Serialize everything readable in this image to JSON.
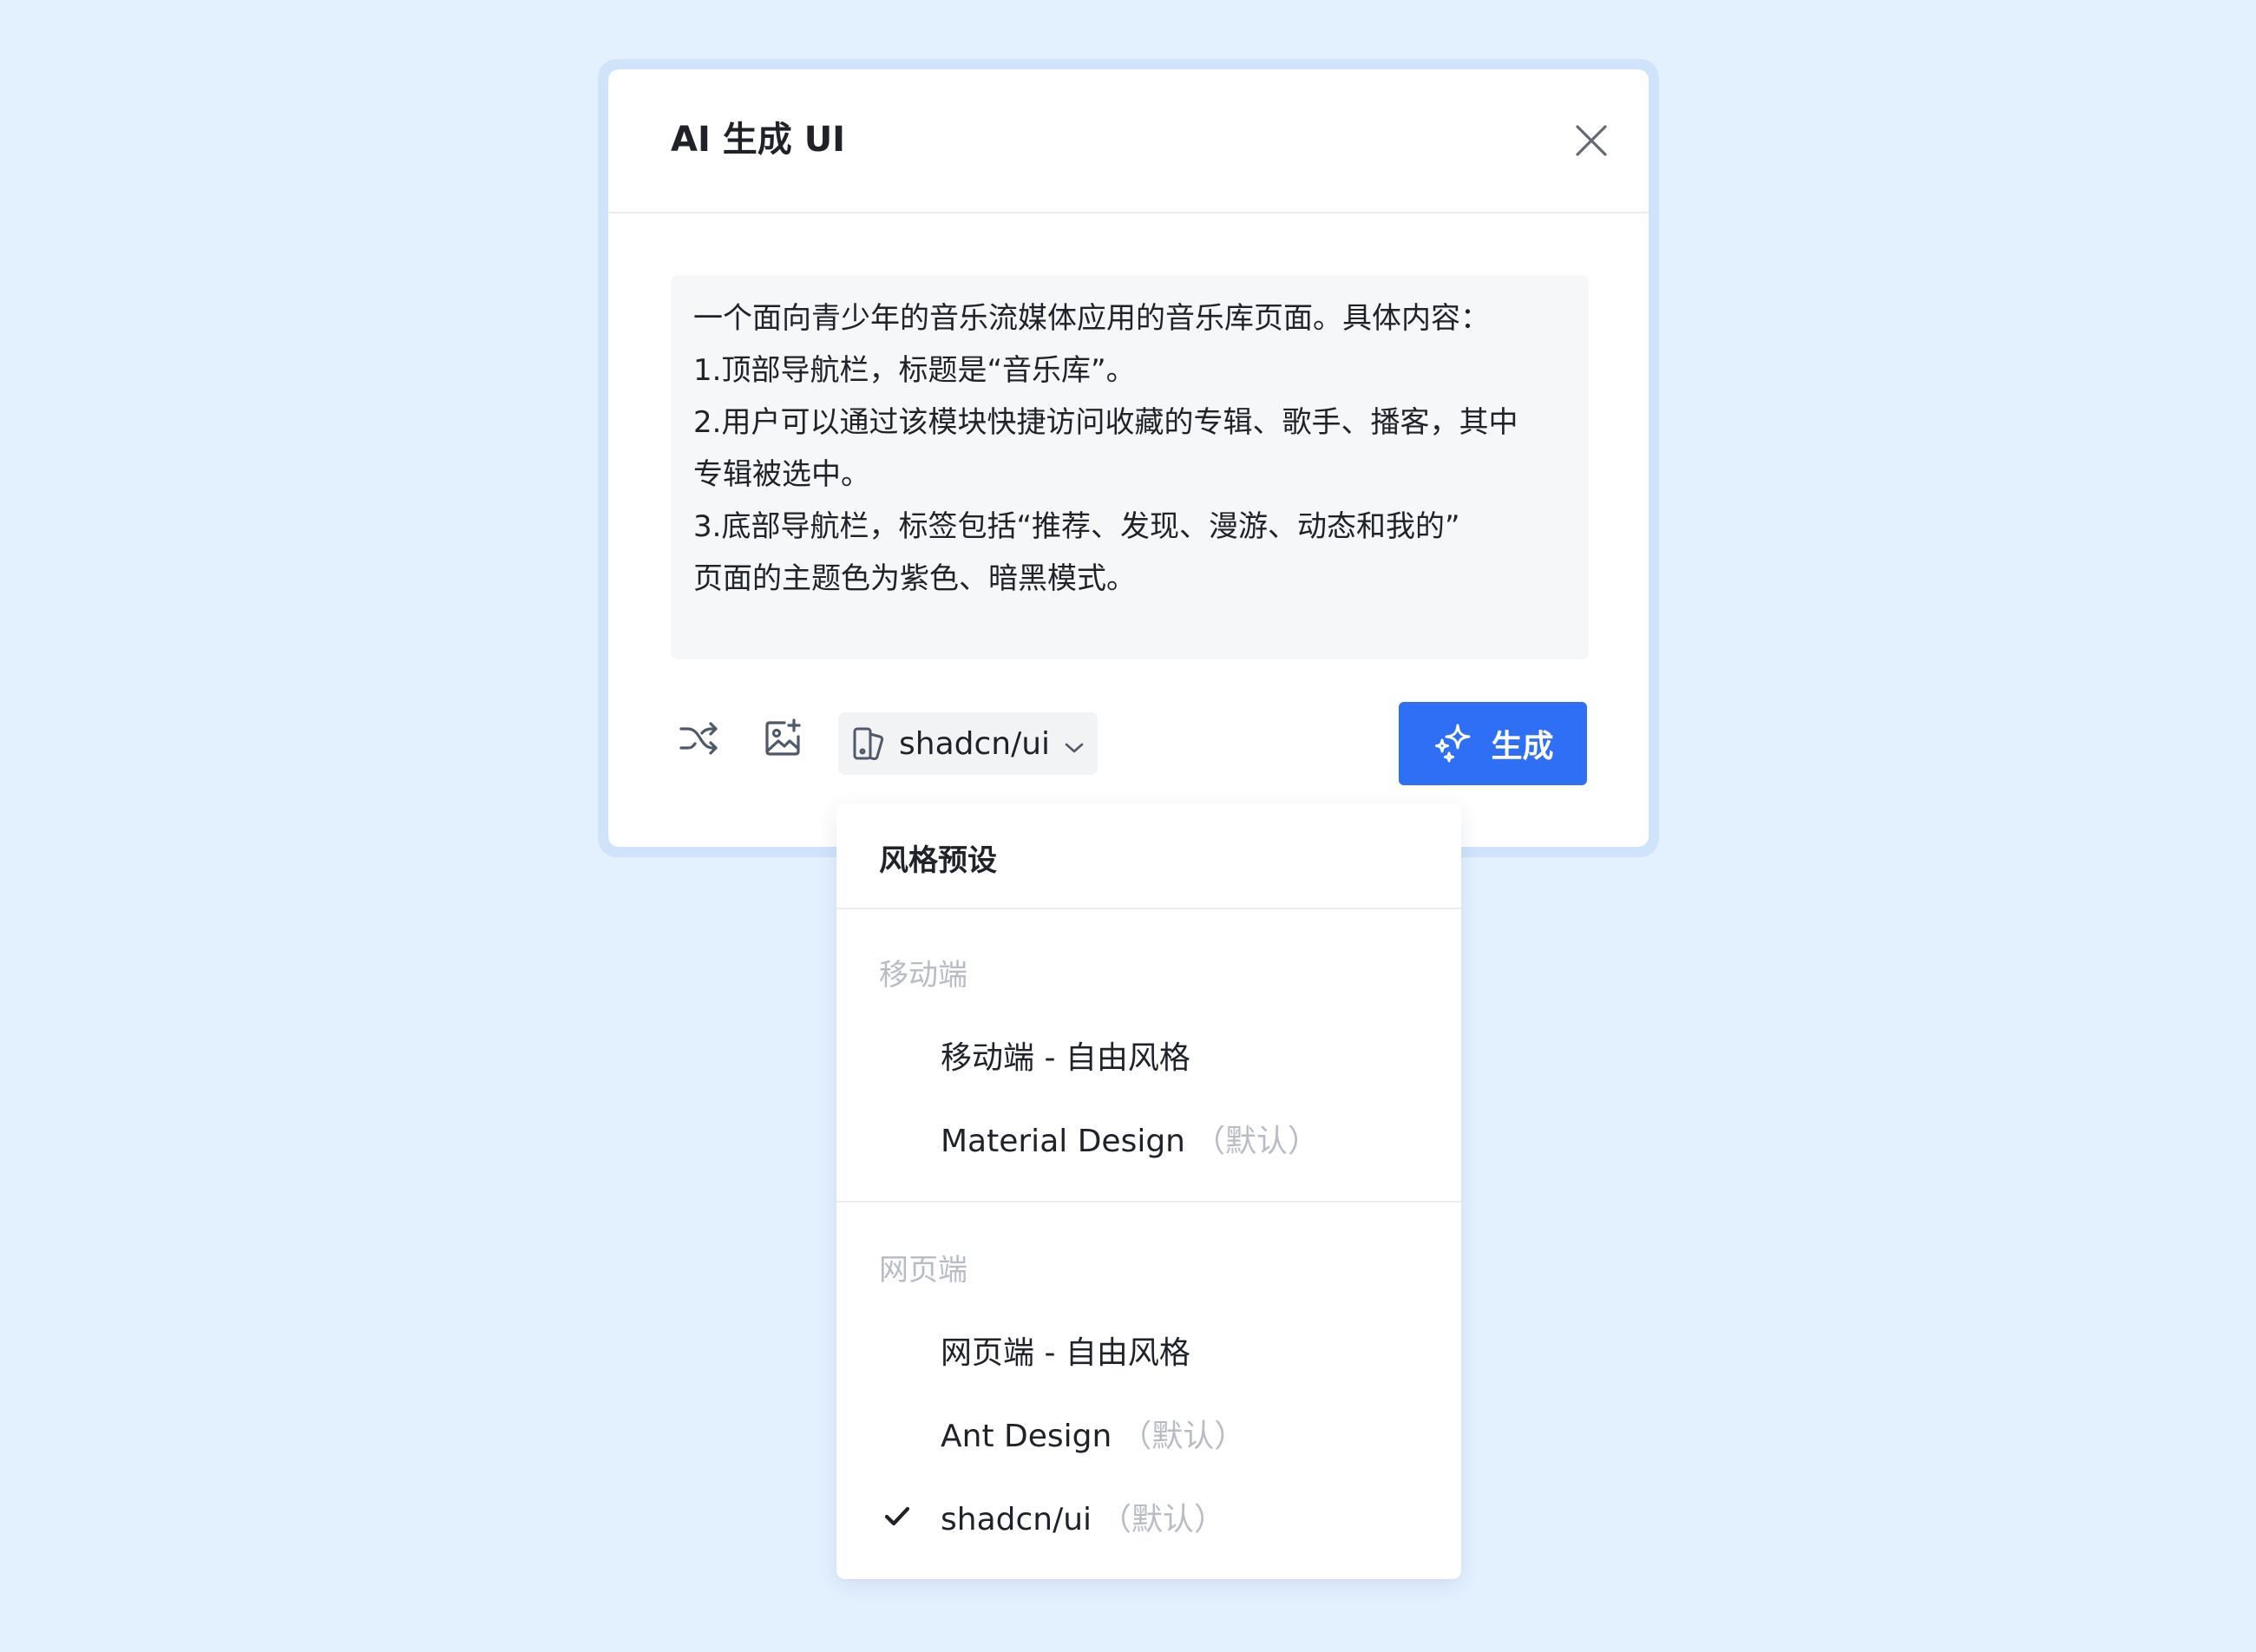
{
  "dialog": {
    "title": "AI 生成 UI",
    "prompt_lines": [
      "一个面向青少年的音乐流媒体应用的音乐库页面。具体内容：",
      "1.顶部导航栏，标题是“音乐库”。",
      "2.用户可以通过该模块快捷访问收藏的专辑、歌手、播客，其中",
      "专辑被选中。",
      "3.底部导航栏，标签包括“推荐、发现、漫游、动态和我的”",
      "页面的主题色为紫色、暗黑模式。"
    ],
    "style_select": "shadcn/ui",
    "generate_label": "生成",
    "icons": {
      "close": "close-icon",
      "shuffle": "shuffle-icon",
      "image_add": "image-add-icon",
      "style": "component-style-icon",
      "chevron": "chevron-down-icon",
      "sparkle": "sparkle-icon"
    }
  },
  "dropdown": {
    "title": "风格预设",
    "groups": [
      {
        "label": "移动端",
        "items": [
          {
            "label": "移动端 - 自由风格",
            "hint": "",
            "selected": false
          },
          {
            "label": "Material Design",
            "hint": "（默认）",
            "selected": false
          }
        ]
      },
      {
        "label": "网页端",
        "items": [
          {
            "label": "网页端 - 自由风格",
            "hint": "",
            "selected": false
          },
          {
            "label": "Ant Design",
            "hint": "（默认）",
            "selected": false
          },
          {
            "label": "shadcn/ui",
            "hint": "（默认）",
            "selected": true
          }
        ]
      }
    ]
  },
  "colors": {
    "background": "#e3f0fe",
    "accent": "#2f6ff6",
    "dialog_border": "#cfe3fb",
    "muted_text": "#b8bcc4"
  }
}
